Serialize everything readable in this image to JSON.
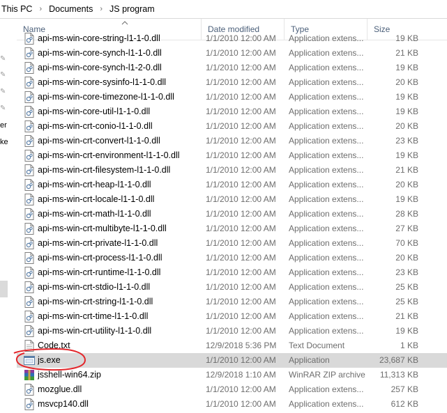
{
  "breadcrumb": {
    "items": [
      "This PC",
      "Documents",
      "JS program"
    ],
    "separator": "›"
  },
  "left_pane": {
    "text_1": "er",
    "text_2": "ke"
  },
  "columns": {
    "name": "Name",
    "date": "Date modified",
    "type": "Type",
    "size": "Size",
    "sort_icon": "chevron-up-icon"
  },
  "files": [
    {
      "name": "api-ms-win-core-string-l1-1-0.dll",
      "date": "1/1/2010 12:00 AM",
      "type": "Application extens...",
      "size": "19 KB",
      "icon": "dll-file-icon"
    },
    {
      "name": "api-ms-win-core-synch-l1-1-0.dll",
      "date": "1/1/2010 12:00 AM",
      "type": "Application extens...",
      "size": "21 KB",
      "icon": "dll-file-icon"
    },
    {
      "name": "api-ms-win-core-synch-l1-2-0.dll",
      "date": "1/1/2010 12:00 AM",
      "type": "Application extens...",
      "size": "19 KB",
      "icon": "dll-file-icon"
    },
    {
      "name": "api-ms-win-core-sysinfo-l1-1-0.dll",
      "date": "1/1/2010 12:00 AM",
      "type": "Application extens...",
      "size": "20 KB",
      "icon": "dll-file-icon"
    },
    {
      "name": "api-ms-win-core-timezone-l1-1-0.dll",
      "date": "1/1/2010 12:00 AM",
      "type": "Application extens...",
      "size": "19 KB",
      "icon": "dll-file-icon"
    },
    {
      "name": "api-ms-win-core-util-l1-1-0.dll",
      "date": "1/1/2010 12:00 AM",
      "type": "Application extens...",
      "size": "19 KB",
      "icon": "dll-file-icon"
    },
    {
      "name": "api-ms-win-crt-conio-l1-1-0.dll",
      "date": "1/1/2010 12:00 AM",
      "type": "Application extens...",
      "size": "20 KB",
      "icon": "dll-file-icon"
    },
    {
      "name": "api-ms-win-crt-convert-l1-1-0.dll",
      "date": "1/1/2010 12:00 AM",
      "type": "Application extens...",
      "size": "23 KB",
      "icon": "dll-file-icon"
    },
    {
      "name": "api-ms-win-crt-environment-l1-1-0.dll",
      "date": "1/1/2010 12:00 AM",
      "type": "Application extens...",
      "size": "19 KB",
      "icon": "dll-file-icon"
    },
    {
      "name": "api-ms-win-crt-filesystem-l1-1-0.dll",
      "date": "1/1/2010 12:00 AM",
      "type": "Application extens...",
      "size": "21 KB",
      "icon": "dll-file-icon"
    },
    {
      "name": "api-ms-win-crt-heap-l1-1-0.dll",
      "date": "1/1/2010 12:00 AM",
      "type": "Application extens...",
      "size": "20 KB",
      "icon": "dll-file-icon"
    },
    {
      "name": "api-ms-win-crt-locale-l1-1-0.dll",
      "date": "1/1/2010 12:00 AM",
      "type": "Application extens...",
      "size": "19 KB",
      "icon": "dll-file-icon"
    },
    {
      "name": "api-ms-win-crt-math-l1-1-0.dll",
      "date": "1/1/2010 12:00 AM",
      "type": "Application extens...",
      "size": "28 KB",
      "icon": "dll-file-icon"
    },
    {
      "name": "api-ms-win-crt-multibyte-l1-1-0.dll",
      "date": "1/1/2010 12:00 AM",
      "type": "Application extens...",
      "size": "27 KB",
      "icon": "dll-file-icon"
    },
    {
      "name": "api-ms-win-crt-private-l1-1-0.dll",
      "date": "1/1/2010 12:00 AM",
      "type": "Application extens...",
      "size": "70 KB",
      "icon": "dll-file-icon"
    },
    {
      "name": "api-ms-win-crt-process-l1-1-0.dll",
      "date": "1/1/2010 12:00 AM",
      "type": "Application extens...",
      "size": "20 KB",
      "icon": "dll-file-icon"
    },
    {
      "name": "api-ms-win-crt-runtime-l1-1-0.dll",
      "date": "1/1/2010 12:00 AM",
      "type": "Application extens...",
      "size": "23 KB",
      "icon": "dll-file-icon"
    },
    {
      "name": "api-ms-win-crt-stdio-l1-1-0.dll",
      "date": "1/1/2010 12:00 AM",
      "type": "Application extens...",
      "size": "25 KB",
      "icon": "dll-file-icon"
    },
    {
      "name": "api-ms-win-crt-string-l1-1-0.dll",
      "date": "1/1/2010 12:00 AM",
      "type": "Application extens...",
      "size": "25 KB",
      "icon": "dll-file-icon"
    },
    {
      "name": "api-ms-win-crt-time-l1-1-0.dll",
      "date": "1/1/2010 12:00 AM",
      "type": "Application extens...",
      "size": "21 KB",
      "icon": "dll-file-icon"
    },
    {
      "name": "api-ms-win-crt-utility-l1-1-0.dll",
      "date": "1/1/2010 12:00 AM",
      "type": "Application extens...",
      "size": "19 KB",
      "icon": "dll-file-icon"
    },
    {
      "name": "Code.txt",
      "date": "12/9/2018 5:36 PM",
      "type": "Text Document",
      "size": "1 KB",
      "icon": "text-file-icon"
    },
    {
      "name": "js.exe",
      "date": "1/1/2010 12:00 AM",
      "type": "Application",
      "size": "23,687 KB",
      "icon": "exe-file-icon",
      "selected": true
    },
    {
      "name": "jsshell-win64.zip",
      "date": "12/9/2018 1:10 AM",
      "type": "WinRAR ZIP archive",
      "size": "11,313 KB",
      "icon": "winrar-zip-icon"
    },
    {
      "name": "mozglue.dll",
      "date": "1/1/2010 12:00 AM",
      "type": "Application extens...",
      "size": "257 KB",
      "icon": "dll-file-icon"
    },
    {
      "name": "msvcp140.dll",
      "date": "1/1/2010 12:00 AM",
      "type": "Application extens...",
      "size": "612 KB",
      "icon": "dll-file-icon"
    }
  ],
  "colors": {
    "header_text": "#4c607a",
    "selection": "#d9d9d9",
    "annotation": "#e3262b",
    "muted_text": "#6d6d6d"
  }
}
